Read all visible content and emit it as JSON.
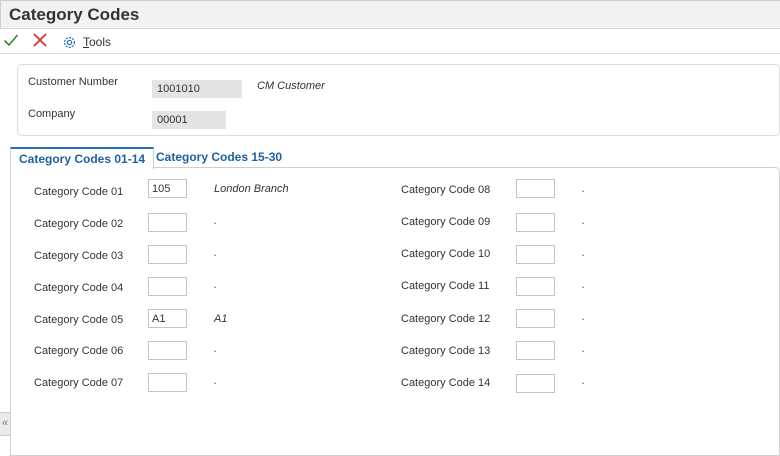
{
  "window": {
    "title": "Category Codes"
  },
  "toolbar": {
    "ok_icon": "checkmark-icon",
    "cancel_icon": "x-icon",
    "tools_icon": "gear-icon",
    "tools_label_first": "T",
    "tools_label_rest": "ools"
  },
  "header": {
    "customer_number_label": "Customer Number",
    "customer_number_value": "1001010",
    "customer_name": "CM Customer",
    "company_label": "Company",
    "company_value": "00001"
  },
  "tabs": [
    {
      "label": "Category Codes 01-14",
      "active": true
    },
    {
      "label": "Category Codes 15-30",
      "active": false
    }
  ],
  "codes_left": [
    {
      "label": "Category Code 01",
      "value": "105",
      "desc": "London Branch"
    },
    {
      "label": "Category Code 02",
      "value": "",
      "desc": "."
    },
    {
      "label": "Category Code 03",
      "value": "",
      "desc": "."
    },
    {
      "label": "Category Code 04",
      "value": "",
      "desc": "."
    },
    {
      "label": "Category Code 05",
      "value": "A1",
      "desc": "A1"
    },
    {
      "label": "Category Code 06",
      "value": "",
      "desc": "."
    },
    {
      "label": "Category Code 07",
      "value": "",
      "desc": "."
    }
  ],
  "codes_right": [
    {
      "label": "Category Code 08",
      "value": "",
      "desc": "."
    },
    {
      "label": "Category Code 09",
      "value": "",
      "desc": "."
    },
    {
      "label": "Category Code 10",
      "value": "",
      "desc": "."
    },
    {
      "label": "Category Code 11",
      "value": "",
      "desc": "."
    },
    {
      "label": "Category Code 12",
      "value": "",
      "desc": "."
    },
    {
      "label": "Category Code 13",
      "value": "",
      "desc": "."
    },
    {
      "label": "Category Code 14",
      "value": "",
      "desc": "."
    }
  ],
  "side_handle": {
    "glyph": "«",
    "icon": "double-chevron-left-icon"
  },
  "colors": {
    "tab_text": "#1f5f9f",
    "tab_accent": "#2a6ebb",
    "ok": "#2e8b2e",
    "cancel": "#d9262a",
    "readonly_bg": "#e4e4e4"
  }
}
